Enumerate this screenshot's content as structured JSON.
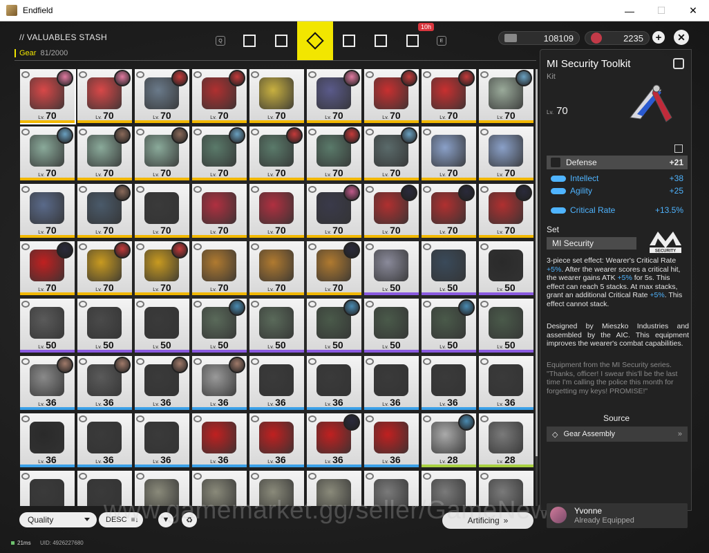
{
  "window": {
    "title": "Endfield",
    "minimize": "—",
    "maximize": "☐",
    "close": "✕"
  },
  "header": {
    "stash_title": "// VALUABLES STASH",
    "gear_label": "Gear",
    "gear_count": "81/2000",
    "key_left": "Q",
    "key_right": "E",
    "tabs": [
      {
        "name": "tab-weapons-icon",
        "active": false
      },
      {
        "name": "tab-kits-icon",
        "active": false
      },
      {
        "name": "tab-gear-icon",
        "active": true
      },
      {
        "name": "tab-materials-icon",
        "active": false
      },
      {
        "name": "tab-consumables-icon",
        "active": false
      },
      {
        "name": "tab-special-icon",
        "active": false,
        "timer": "10h"
      }
    ],
    "currency_1": "108109",
    "currency_2": "2235",
    "plus": "+",
    "close": "✕"
  },
  "grid": {
    "rows": [
      [
        {
          "lv": "70",
          "rarity": "gold",
          "color": "#d84848",
          "avatar": "#e07aa0"
        },
        {
          "lv": "70",
          "rarity": "gold",
          "color": "#d84848",
          "avatar": "#e07aa0"
        },
        {
          "lv": "70",
          "rarity": "gold",
          "color": "#6a7a8a",
          "avatar": "#c43a3a"
        },
        {
          "lv": "70",
          "rarity": "gold",
          "color": "#b03030",
          "avatar": "#c43a3a"
        },
        {
          "lv": "70",
          "rarity": "gold",
          "color": "#c8b040",
          "avatar": ""
        },
        {
          "lv": "70",
          "rarity": "gold",
          "color": "#5a5a8a",
          "avatar": "#e07aa0"
        },
        {
          "lv": "70",
          "rarity": "gold",
          "color": "#c83030",
          "avatar": "#c43a3a"
        },
        {
          "lv": "70",
          "rarity": "gold",
          "color": "#c83030",
          "avatar": "#c43a3a"
        },
        {
          "lv": "70",
          "rarity": "gold",
          "color": "#9aaa9a",
          "avatar": "#6aa0c0"
        }
      ],
      [
        {
          "lv": "70",
          "rarity": "gold",
          "color": "#8aaa9a",
          "avatar": "#6aa0c0"
        },
        {
          "lv": "70",
          "rarity": "gold",
          "color": "#8aaa9a",
          "avatar": "#8a6a5a"
        },
        {
          "lv": "70",
          "rarity": "gold",
          "color": "#8aaa9a",
          "avatar": "#8a6a5a"
        },
        {
          "lv": "70",
          "rarity": "gold",
          "color": "#5a7a6a",
          "avatar": "#6aa0c0"
        },
        {
          "lv": "70",
          "rarity": "gold",
          "color": "#5a7a6a",
          "avatar": "#c43a3a"
        },
        {
          "lv": "70",
          "rarity": "gold",
          "color": "#5a7a6a",
          "avatar": "#c43a3a"
        },
        {
          "lv": "70",
          "rarity": "gold",
          "color": "#5a6a6a",
          "avatar": "#6aa0c0"
        },
        {
          "lv": "70",
          "rarity": "gold",
          "color": "#8aa0c8",
          "avatar": ""
        },
        {
          "lv": "70",
          "rarity": "gold",
          "color": "#8aa0c8",
          "avatar": ""
        }
      ],
      [
        {
          "lv": "70",
          "rarity": "gold",
          "color": "#5a6a8a",
          "avatar": ""
        },
        {
          "lv": "70",
          "rarity": "gold",
          "color": "#4a5a6a",
          "avatar": "#8a6a5a"
        },
        {
          "lv": "70",
          "rarity": "gold",
          "color": "#3a3a3a",
          "avatar": ""
        },
        {
          "lv": "70",
          "rarity": "gold",
          "color": "#b03040",
          "avatar": ""
        },
        {
          "lv": "70",
          "rarity": "gold",
          "color": "#b03040",
          "avatar": ""
        },
        {
          "lv": "70",
          "rarity": "gold",
          "color": "#3a3a4a",
          "avatar": "#c05a8a"
        },
        {
          "lv": "70",
          "rarity": "gold",
          "color": "#b03030",
          "avatar": "#2a2a3a"
        },
        {
          "lv": "70",
          "rarity": "gold",
          "color": "#b03030",
          "avatar": "#2a2a3a"
        },
        {
          "lv": "70",
          "rarity": "gold",
          "color": "#b03030",
          "avatar": "#2a2a3a"
        }
      ],
      [
        {
          "lv": "70",
          "rarity": "gold",
          "color": "#c02020",
          "avatar": "#2a2a3a"
        },
        {
          "lv": "70",
          "rarity": "gold",
          "color": "#c89a20",
          "avatar": "#c43a3a"
        },
        {
          "lv": "70",
          "rarity": "gold",
          "color": "#c89a20",
          "avatar": "#c43a3a"
        },
        {
          "lv": "70",
          "rarity": "gold",
          "color": "#b07a30",
          "avatar": ""
        },
        {
          "lv": "70",
          "rarity": "gold",
          "color": "#b07a30",
          "avatar": ""
        },
        {
          "lv": "70",
          "rarity": "gold",
          "color": "#b07a30",
          "avatar": "#2a2a3a"
        },
        {
          "lv": "50",
          "rarity": "purple",
          "color": "#8a8a9a",
          "avatar": ""
        },
        {
          "lv": "50",
          "rarity": "purple",
          "color": "#3a4a5a",
          "avatar": ""
        },
        {
          "lv": "50",
          "rarity": "purple",
          "color": "#2a2a2a",
          "avatar": ""
        }
      ],
      [
        {
          "lv": "50",
          "rarity": "purple",
          "color": "#5a5a5a",
          "avatar": ""
        },
        {
          "lv": "50",
          "rarity": "purple",
          "color": "#4a4a4a",
          "avatar": ""
        },
        {
          "lv": "50",
          "rarity": "purple",
          "color": "#3a3a3a",
          "avatar": ""
        },
        {
          "lv": "50",
          "rarity": "purple",
          "color": "#5a6a5a",
          "avatar": "#4a8ab0"
        },
        {
          "lv": "50",
          "rarity": "purple",
          "color": "#5a6a5a",
          "avatar": ""
        },
        {
          "lv": "50",
          "rarity": "purple",
          "color": "#4a5a4a",
          "avatar": "#4a8ab0"
        },
        {
          "lv": "50",
          "rarity": "purple",
          "color": "#4a5a4a",
          "avatar": ""
        },
        {
          "lv": "50",
          "rarity": "purple",
          "color": "#4a5a4a",
          "avatar": "#4a8ab0"
        },
        {
          "lv": "50",
          "rarity": "purple",
          "color": "#4a5a4a",
          "avatar": ""
        }
      ],
      [
        {
          "lv": "36",
          "rarity": "blue",
          "color": "#8a8a8a",
          "avatar": "#a07a6a"
        },
        {
          "lv": "36",
          "rarity": "blue",
          "color": "#5a5a5a",
          "avatar": "#a07a6a"
        },
        {
          "lv": "36",
          "rarity": "blue",
          "color": "#3a3a3a",
          "avatar": "#a07a6a"
        },
        {
          "lv": "36",
          "rarity": "blue",
          "color": "#9a9a9a",
          "avatar": "#a07a6a"
        },
        {
          "lv": "36",
          "rarity": "blue",
          "color": "#3a3a3a",
          "avatar": ""
        },
        {
          "lv": "36",
          "rarity": "blue",
          "color": "#3a3a3a",
          "avatar": ""
        },
        {
          "lv": "36",
          "rarity": "blue",
          "color": "#3a3a3a",
          "avatar": ""
        },
        {
          "lv": "36",
          "rarity": "blue",
          "color": "#3a3a3a",
          "avatar": ""
        },
        {
          "lv": "36",
          "rarity": "blue",
          "color": "#3a3a3a",
          "avatar": ""
        }
      ],
      [
        {
          "lv": "36",
          "rarity": "blue",
          "color": "#2a2a2a",
          "avatar": ""
        },
        {
          "lv": "36",
          "rarity": "blue",
          "color": "#3a3a3a",
          "avatar": ""
        },
        {
          "lv": "36",
          "rarity": "blue",
          "color": "#3a3a3a",
          "avatar": ""
        },
        {
          "lv": "36",
          "rarity": "blue",
          "color": "#c02020",
          "avatar": ""
        },
        {
          "lv": "36",
          "rarity": "blue",
          "color": "#c02020",
          "avatar": ""
        },
        {
          "lv": "36",
          "rarity": "blue",
          "color": "#c02020",
          "avatar": "#2a2a3a"
        },
        {
          "lv": "36",
          "rarity": "blue",
          "color": "#c02020",
          "avatar": ""
        },
        {
          "lv": "28",
          "rarity": "green",
          "color": "#aaaaaa",
          "avatar": "#4a8ab0"
        },
        {
          "lv": "28",
          "rarity": "green",
          "color": "#7a7a7a",
          "avatar": ""
        }
      ],
      [
        {
          "lv": "",
          "rarity": "",
          "color": "#3a3a3a",
          "avatar": ""
        },
        {
          "lv": "",
          "rarity": "",
          "color": "#3a3a3a",
          "avatar": ""
        },
        {
          "lv": "",
          "rarity": "",
          "color": "#8a8a7a",
          "avatar": ""
        },
        {
          "lv": "",
          "rarity": "",
          "color": "#8a8a7a",
          "avatar": ""
        },
        {
          "lv": "",
          "rarity": "",
          "color": "#8a8a7a",
          "avatar": ""
        },
        {
          "lv": "",
          "rarity": "",
          "color": "#8a8a7a",
          "avatar": ""
        },
        {
          "lv": "",
          "rarity": "",
          "color": "#7a7a7a",
          "avatar": ""
        },
        {
          "lv": "",
          "rarity": "",
          "color": "#7a7a7a",
          "avatar": ""
        },
        {
          "lv": "",
          "rarity": "",
          "color": "#7a7a7a",
          "avatar": ""
        }
      ]
    ],
    "lv_prefix": "Lv."
  },
  "bottom": {
    "sort": "Quality",
    "order": "DESC",
    "filter_icon": "filter-icon",
    "recycle_icon": "recycle-icon",
    "artificing": "Artificing",
    "ping": "21ms",
    "uid": "UID: 4926227680",
    "watermark": "www.gamemarket.gg/seller/GameNews"
  },
  "panel": {
    "title": "MI Security Toolkit",
    "subtitle": "Kit",
    "lv_prefix": "Lv.",
    "level": "70",
    "main_stat": {
      "label": "Defense",
      "value": "+21"
    },
    "stats": [
      {
        "label": "Intellect",
        "value": "+38"
      },
      {
        "label": "Agility",
        "value": "+25"
      },
      {
        "label": "Critical Rate",
        "value": "+13.5%"
      }
    ],
    "set_label": "Set",
    "set_name": "MI Security",
    "set_logo_text": "SECURITY",
    "set_desc_1": "3-piece set effect: Wearer's Critical Rate ",
    "set_desc_hl1": "+5%",
    "set_desc_2": ". After the wearer scores a critical hit, the wearer gains ATK ",
    "set_desc_hl2": "+5%",
    "set_desc_3": " for 5s. This effect can reach 5 stacks. At max stacks, grant an additional Critical Rate ",
    "set_desc_hl3": "+5%",
    "set_desc_4": ". This effect cannot stack.",
    "flavor": "Designed by Mieszko Industries and assembled by the AIC. This equipment improves the wearer's combat capabilities.",
    "quote": "Equipment from the MI Security series. \"Thanks, officer! I swear this'll be the last time I'm calling the police this month for forgetting my keys! PROMISE!\"",
    "source_label": "Source",
    "source_btn": "Gear Assembly",
    "source_arrow": "»",
    "equipped_name": "Yvonne",
    "equipped_status": "Already Equipped"
  }
}
